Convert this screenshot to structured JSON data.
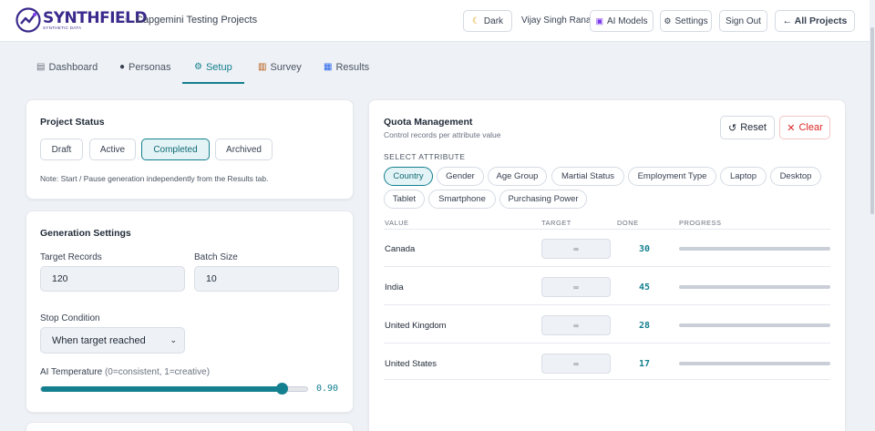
{
  "header": {
    "logo_word": "SYNTHFIELD",
    "logo_sub": "SYNTHETIC DATA",
    "breadcrumb_sep": "›",
    "project_title": "Capgemini Testing Projects",
    "theme_label": "Dark",
    "user_name": "Vijay Singh Rana",
    "ai_models_label": "AI Models",
    "settings_label": "Settings",
    "sign_out_label": "Sign Out",
    "all_projects_label": "← All Projects"
  },
  "tabs": [
    {
      "label": "Dashboard",
      "icon": "chart-icon"
    },
    {
      "label": "Personas",
      "icon": "person-icon"
    },
    {
      "label": "Setup",
      "icon": "gear-icon"
    },
    {
      "label": "Survey",
      "icon": "clipboard-icon"
    },
    {
      "label": "Results",
      "icon": "bar-chart-icon"
    }
  ],
  "active_tab": "Setup",
  "project_status": {
    "title": "Project Status",
    "options": [
      "Draft",
      "Active",
      "Completed",
      "Archived"
    ],
    "selected": "Completed",
    "note": "Note: Start / Pause generation independently from the Results tab."
  },
  "generation": {
    "title": "Generation Settings",
    "target_label": "Target Records",
    "target_value": "120",
    "batch_label": "Batch Size",
    "batch_value": "10",
    "stop_label": "Stop Condition",
    "stop_value": "When target reached",
    "temp_label": "AI Temperature",
    "temp_hint": "(0=consistent, 1=creative)",
    "temp_value": "0.90",
    "temp_level": 0.9
  },
  "quota": {
    "title": "Quota Management",
    "subtitle": "Control records per attribute value",
    "reset_label": "Reset",
    "clear_label": "Clear",
    "select_label": "SELECT ATTRIBUTE",
    "attributes": [
      "Country",
      "Gender",
      "Age Group",
      "Martial Status",
      "Employment Type",
      "Laptop",
      "Desktop",
      "Tablet",
      "Smartphone",
      "Purchasing Power"
    ],
    "selected_attribute": "Country",
    "columns": [
      "VALUE",
      "TARGET",
      "DONE",
      "PROGRESS"
    ],
    "rows": [
      {
        "value": "Canada",
        "target": "∞",
        "done": "30",
        "progress": 0
      },
      {
        "value": "India",
        "target": "∞",
        "done": "45",
        "progress": 0
      },
      {
        "value": "United Kingdom",
        "target": "∞",
        "done": "28",
        "progress": 0
      },
      {
        "value": "United States",
        "target": "∞",
        "done": "17",
        "progress": 0
      }
    ]
  },
  "colors": {
    "accent": "#14808f",
    "brand": "#3b2a8c",
    "danger": "#dc2626"
  }
}
